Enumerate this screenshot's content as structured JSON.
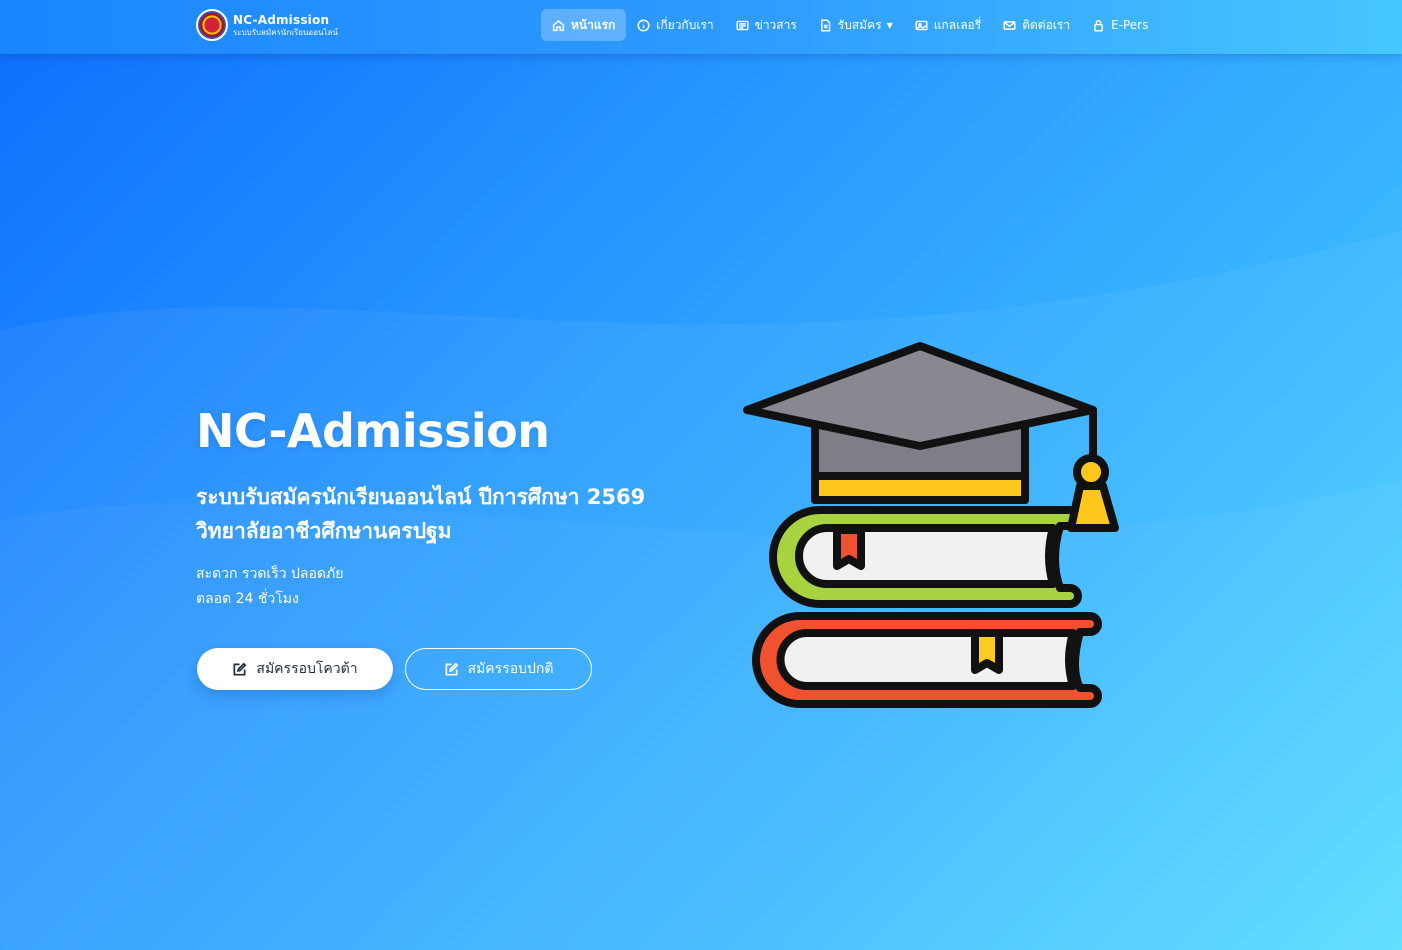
{
  "brand": {
    "title": "NC-Admission",
    "subtitle": "ระบบรับสมัครนักเรียนออนไลน์"
  },
  "nav": {
    "items": [
      {
        "label": "หน้าแรก",
        "icon": "home-icon",
        "active": true
      },
      {
        "label": "เกี่ยวกับเรา",
        "icon": "info-icon"
      },
      {
        "label": "ข่าวสาร",
        "icon": "newspaper-icon"
      },
      {
        "label": "รับสมัคร",
        "icon": "document-icon",
        "dropdown": true
      },
      {
        "label": "แกลเลอรี่",
        "icon": "image-icon"
      },
      {
        "label": "ติดต่อเรา",
        "icon": "mail-icon"
      },
      {
        "label": "E-Pers",
        "icon": "lock-icon"
      }
    ]
  },
  "hero": {
    "title": "NC-Admission",
    "subtitle_line1": "ระบบรับสมัครนักเรียนออนไลน์ ปีการศึกษา 2569",
    "subtitle_line2": "วิทยาลัยอาชีวศึกษานครปฐม",
    "desc_line1": "สะดวก รวดเร็ว ปลอดภัย",
    "desc_line2": "ตลอด 24 ชั่วโมง",
    "button_quota": "สมัครรอบโควต้า",
    "button_normal": "สมัครรอบปกติ"
  },
  "illustration": {
    "icon": "graduation-cap-books-icon"
  },
  "colors": {
    "background_start": "#0d6efd",
    "background_end": "#56dcff",
    "text": "#ffffff"
  }
}
